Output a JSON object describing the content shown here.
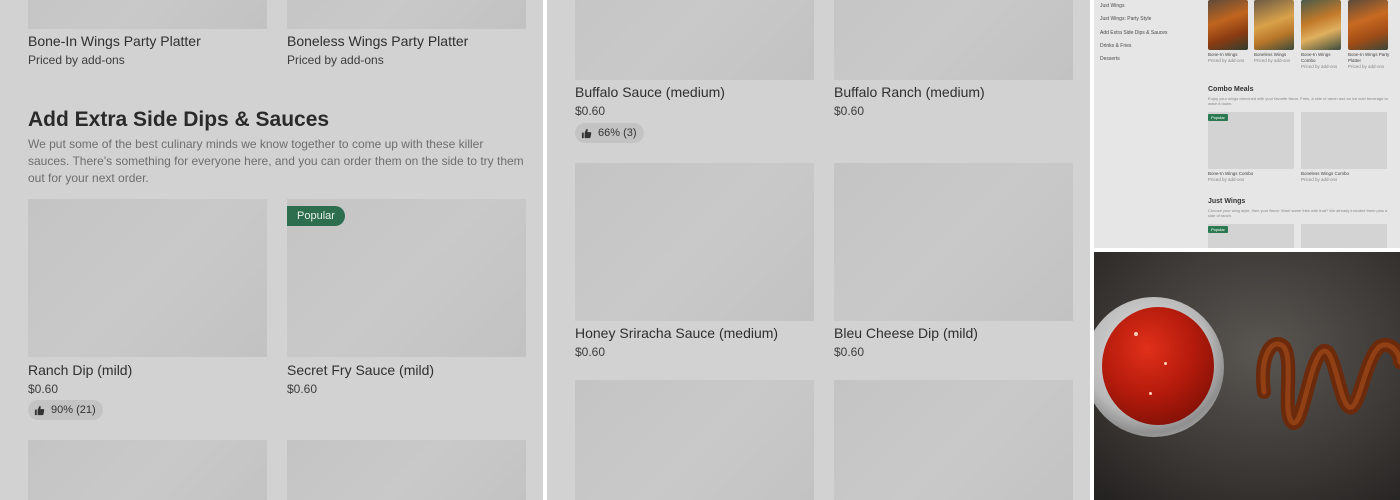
{
  "panel1": {
    "top_items": [
      {
        "name": "Bone-In Wings Party Platter",
        "sub": "Priced by add-ons"
      },
      {
        "name": "Boneless Wings Party Platter",
        "sub": "Priced by add-ons"
      }
    ],
    "section": {
      "title": "Add Extra Side Dips & Sauces",
      "description": "We put some of the best culinary minds we know together to come up with these killer sauces. There's something for everyone here, and you can order them on the side to try them out for your next order."
    },
    "items": [
      {
        "name": "Ranch Dip (mild)",
        "price": "$0.60",
        "rating": "90% (21)"
      },
      {
        "name": "Secret Fry Sauce (mild)",
        "price": "$0.60",
        "badge": "Popular"
      }
    ]
  },
  "panel2": {
    "items": [
      {
        "name": "Buffalo Sauce (medium)",
        "price": "$0.60",
        "rating": "66% (3)"
      },
      {
        "name": "Buffalo Ranch (medium)",
        "price": "$0.60"
      },
      {
        "name": "Honey Sriracha Sauce (medium)",
        "price": "$0.60"
      },
      {
        "name": "Bleu Cheese Dip (mild)",
        "price": "$0.60"
      }
    ]
  },
  "panel3": {
    "nav": [
      "Just Wings",
      "Just Wings: Party Style",
      "Add Extra Side Dips & Sauces",
      "Drinks & Fries",
      "Desserts"
    ],
    "top_items": [
      {
        "name": "Bone-In Wings",
        "sub": "Priced by add-ons"
      },
      {
        "name": "Boneless Wings",
        "sub": "Priced by add-ons"
      },
      {
        "name": "Bone-In Wings Combo",
        "sub": "Priced by add-ons"
      },
      {
        "name": "Bone-In Wings Party Platter",
        "sub": "Priced by add-ons"
      }
    ],
    "combo": {
      "title": "Combo Meals",
      "description": "Enjoy your wings drenched with your favorite flavor. Fries, a side of ranch and an ice cold beverage to wash it down.",
      "badge": "Popular",
      "items": [
        {
          "name": "Bone-In Wings Combo",
          "sub": "Priced by add-ons"
        },
        {
          "name": "Boneless Wings Combo",
          "sub": "Priced by add-ons"
        }
      ]
    },
    "just_wings": {
      "title": "Just Wings",
      "description": "Choose your wing style, then your flavor. Want some fries with that? We already included them plus a side of ranch.",
      "badge": "Popular"
    }
  },
  "colors": {
    "badge_green": "#2c6e4d",
    "overlay_gray": "#d2d2d2"
  },
  "icons": {
    "rating": "thumbs-up-icon"
  }
}
